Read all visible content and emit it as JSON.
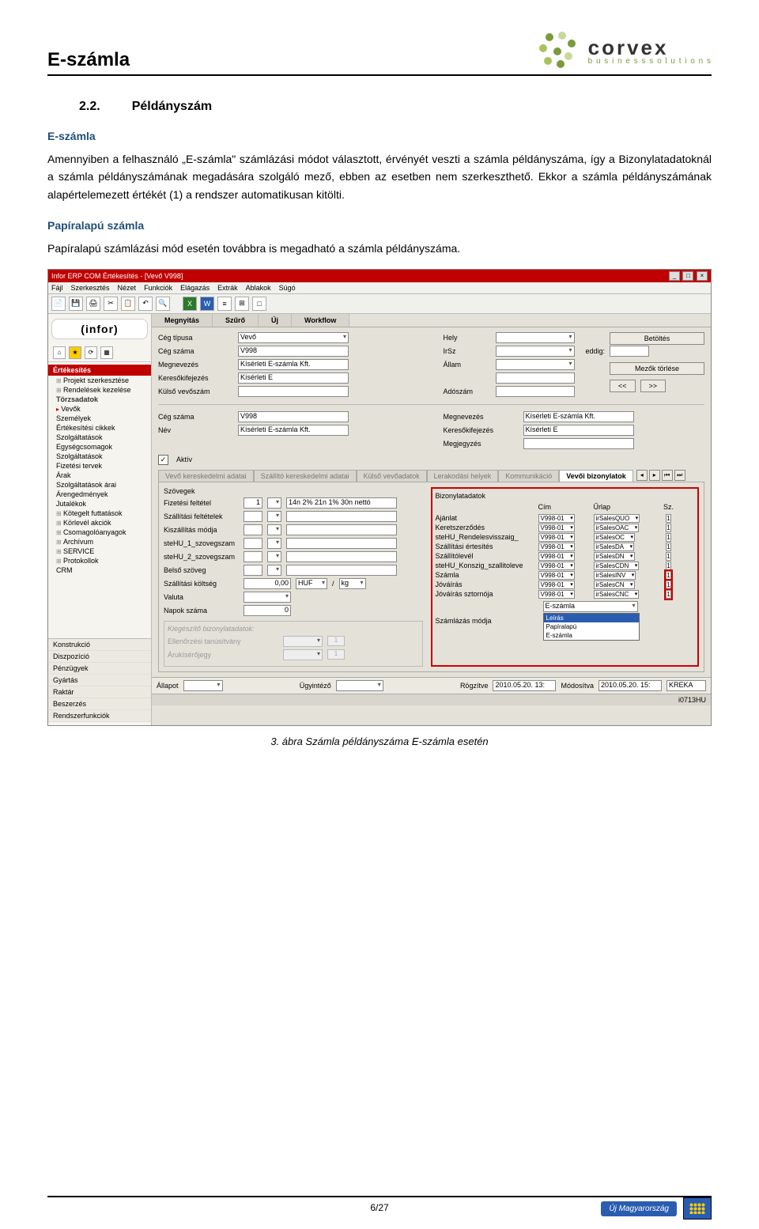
{
  "header": {
    "title": "E-számla"
  },
  "logo": {
    "main": "corvex",
    "sub": "b u s i n e s s   s o l u t i o n s"
  },
  "section": {
    "number": "2.2.",
    "title": "Példányszám"
  },
  "sub1": {
    "heading": "E-számla",
    "para": "Amennyiben a felhasználó „E-számla\" számlázási módot választott, érvényét veszti a számla példányszáma, így a Bizonylatadatoknál a számla példányszámának megadására szolgáló mező, ebben az esetben nem szerkeszthető. Ekkor a számla példányszámának alapértelemezett értékét (1) a rendszer automatikusan kitölti."
  },
  "sub2": {
    "heading": "Papíralapú számla",
    "para": "Papíralapú számlázási mód esetén továbbra is megadható a számla példányszáma."
  },
  "caption": "3. ábra Számla példányszáma E-számla esetén",
  "pagefoot": "6/27",
  "footer_logo_text": "Új Magyarország",
  "screenshot": {
    "title": "Infor ERP COM Értékesítés - [Vevő V998]",
    "menu": [
      "Fájl",
      "Szerkesztés",
      "Nézet",
      "Funkciók",
      "Elágazás",
      "Extrák",
      "Ablakok",
      "Súgó"
    ],
    "brand": "(infor)",
    "sidebar_header": "Értékesítés",
    "tree": [
      {
        "t": "Projekt szerkesztése",
        "plus": true
      },
      {
        "t": "Rendelések kezelése",
        "plus": true
      },
      {
        "t": "Törzsadatok",
        "bold": true
      },
      {
        "t": "Vevők",
        "arrow": true
      },
      {
        "t": "Személyek"
      },
      {
        "t": "Értékesítési cikkek"
      },
      {
        "t": "Szolgáltatások"
      },
      {
        "t": "Egységcsomagok"
      },
      {
        "t": "Szolgáltatások"
      },
      {
        "t": "Fizetési tervek"
      },
      {
        "t": "Árak"
      },
      {
        "t": "Szolgáltatások árai"
      },
      {
        "t": "Árengedmények"
      },
      {
        "t": "Jutalékok"
      },
      {
        "t": "Kötegelt futtatások",
        "plus": true
      },
      {
        "t": "Körlevél akciók",
        "plus": true
      },
      {
        "t": "Csomagolóanyagok",
        "plus": true
      },
      {
        "t": "Archívum",
        "plus": true
      },
      {
        "t": "SERVICE",
        "plus": true
      },
      {
        "t": "Protokollok",
        "plus": true
      },
      {
        "t": "CRM"
      }
    ],
    "sidebar_bottom": [
      "Konstrukció",
      "Diszpozíció",
      "Pénzügyek",
      "Gyártás",
      "Raktár",
      "Beszerzés",
      "Rendszerfunkciók"
    ],
    "tabs_top": [
      "Megnyitás",
      "Szűrő",
      "Új",
      "Workflow"
    ],
    "btn_load": "Betöltés",
    "btn_clear": "Mezők törlése",
    "btn_prev": "<<",
    "btn_next": ">>",
    "top_form_left": [
      {
        "l": "Cég típusa",
        "v": "Vevő",
        "sel": true
      },
      {
        "l": "Cég száma",
        "v": "V998"
      },
      {
        "l": "Megnevezés",
        "v": "Kísérleti E-számla Kft."
      },
      {
        "l": "Keresőkifejezés",
        "v": "Kísérleti E"
      },
      {
        "l": "Külső vevőszám",
        "v": ""
      }
    ],
    "top_form_right": [
      {
        "l": "Hely",
        "v": "",
        "sel": true
      },
      {
        "l": "IrSz",
        "v": "",
        "sel": true,
        "extra": "eddig:"
      },
      {
        "l": "Állam",
        "v": "",
        "sel": true
      },
      {
        "l": "",
        "v": ""
      },
      {
        "l": "Adószám",
        "v": ""
      }
    ],
    "mid_left": [
      {
        "l": "Cég száma",
        "v": "V998"
      },
      {
        "l": "Név",
        "v": "Kísérleti E-számla Kft."
      }
    ],
    "mid_right": [
      {
        "l": "Megnevezés",
        "v": "Kísérleti E-számla Kft."
      },
      {
        "l": "Keresőkifejezés",
        "v": "Kísérleti E"
      },
      {
        "l": "Megjegyzés",
        "v": ""
      }
    ],
    "aktiv_label": "Aktív",
    "inner_tabs": [
      "Vevő kereskedelmi adatai",
      "Szállító kereskedelmi adatai",
      "Külső vevőadatok",
      "Lerakodási helyek",
      "Kommunikáció",
      "Vevői bizonylatok"
    ],
    "inner_active": 5,
    "left_panel": {
      "rows": [
        {
          "l": "Szövegek"
        },
        {
          "l": "Fizetési feltétel",
          "n": "1",
          "v": "14n 2% 21n 1% 30n nettó"
        },
        {
          "l": "Szállítási feltételek",
          "n": "",
          "v": ""
        },
        {
          "l": "Kiszállítás módja",
          "n": "",
          "v": ""
        },
        {
          "l": "steHU_1_szovegszam",
          "n": "",
          "v": ""
        },
        {
          "l": "steHU_2_szovegszam",
          "n": "",
          "v": ""
        },
        {
          "l": "Belső szöveg",
          "n": "",
          "v": ""
        }
      ],
      "shipcost": {
        "l": "Szállítási költség",
        "v": "0,00",
        "cur": "HUF",
        "per": "/",
        "unit": "kg"
      },
      "valuta": "Valuta",
      "napok": {
        "l": "Napok száma",
        "v": "0"
      },
      "kieg_title": "Kiegészítő bizonylatadatok:",
      "kieg_rows": [
        {
          "l": "Ellenőrzési tanúsítvány",
          "v": "1"
        },
        {
          "l": "Árukísérőjegy",
          "v": "1"
        }
      ]
    },
    "right_panel": {
      "title": "Bizonylatadatok",
      "headers": [
        "",
        "Cím",
        "Űrlap",
        "Sz."
      ],
      "rows": [
        {
          "l": "Ajánlat",
          "c": "V998-01",
          "u": "irSalesQUO",
          "s": "1"
        },
        {
          "l": "Keretszerződés",
          "c": "V998-01",
          "u": "irSalesOAC",
          "s": "1"
        },
        {
          "l": "steHU_Rendelesvisszaig_",
          "c": "V998-01",
          "u": "irSalesOC",
          "s": "1"
        },
        {
          "l": "Szállítási értesítés",
          "c": "V998-01",
          "u": "irSalesDA",
          "s": "1"
        },
        {
          "l": "Szállítólevél",
          "c": "V998-01",
          "u": "irSalesDN",
          "s": "1"
        },
        {
          "l": "steHU_Konszig_szallitoleve",
          "c": "V998-01",
          "u": "irSalesCDN",
          "s": "1"
        },
        {
          "l": "Számla",
          "c": "V998-01",
          "u": "irSalesINV",
          "s": "1",
          "hl": true
        },
        {
          "l": "Jóváírás",
          "c": "V998-01",
          "u": "irSalesCN",
          "s": "1",
          "hl": true
        },
        {
          "l": "Jóváírás sztornója",
          "c": "V998-01",
          "u": "irSalesCNC",
          "s": "1",
          "hl": true
        }
      ],
      "mode_label": "Számlázás módja",
      "mode_value": "E-számla",
      "dropdown": [
        "Leírás",
        "Papíralapú",
        "E-számla"
      ],
      "dropdown_sel": 0
    },
    "status": {
      "allapot_l": "Állapot",
      "ugy_l": "Ügyintéző",
      "rogz_l": "Rögzítve",
      "rogz_v": "2010.05.20. 13:",
      "mod_l": "Módosítva",
      "mod_v": "2010.05.20. 15:",
      "user": "KREKA"
    },
    "bottom": "i0713HU"
  }
}
